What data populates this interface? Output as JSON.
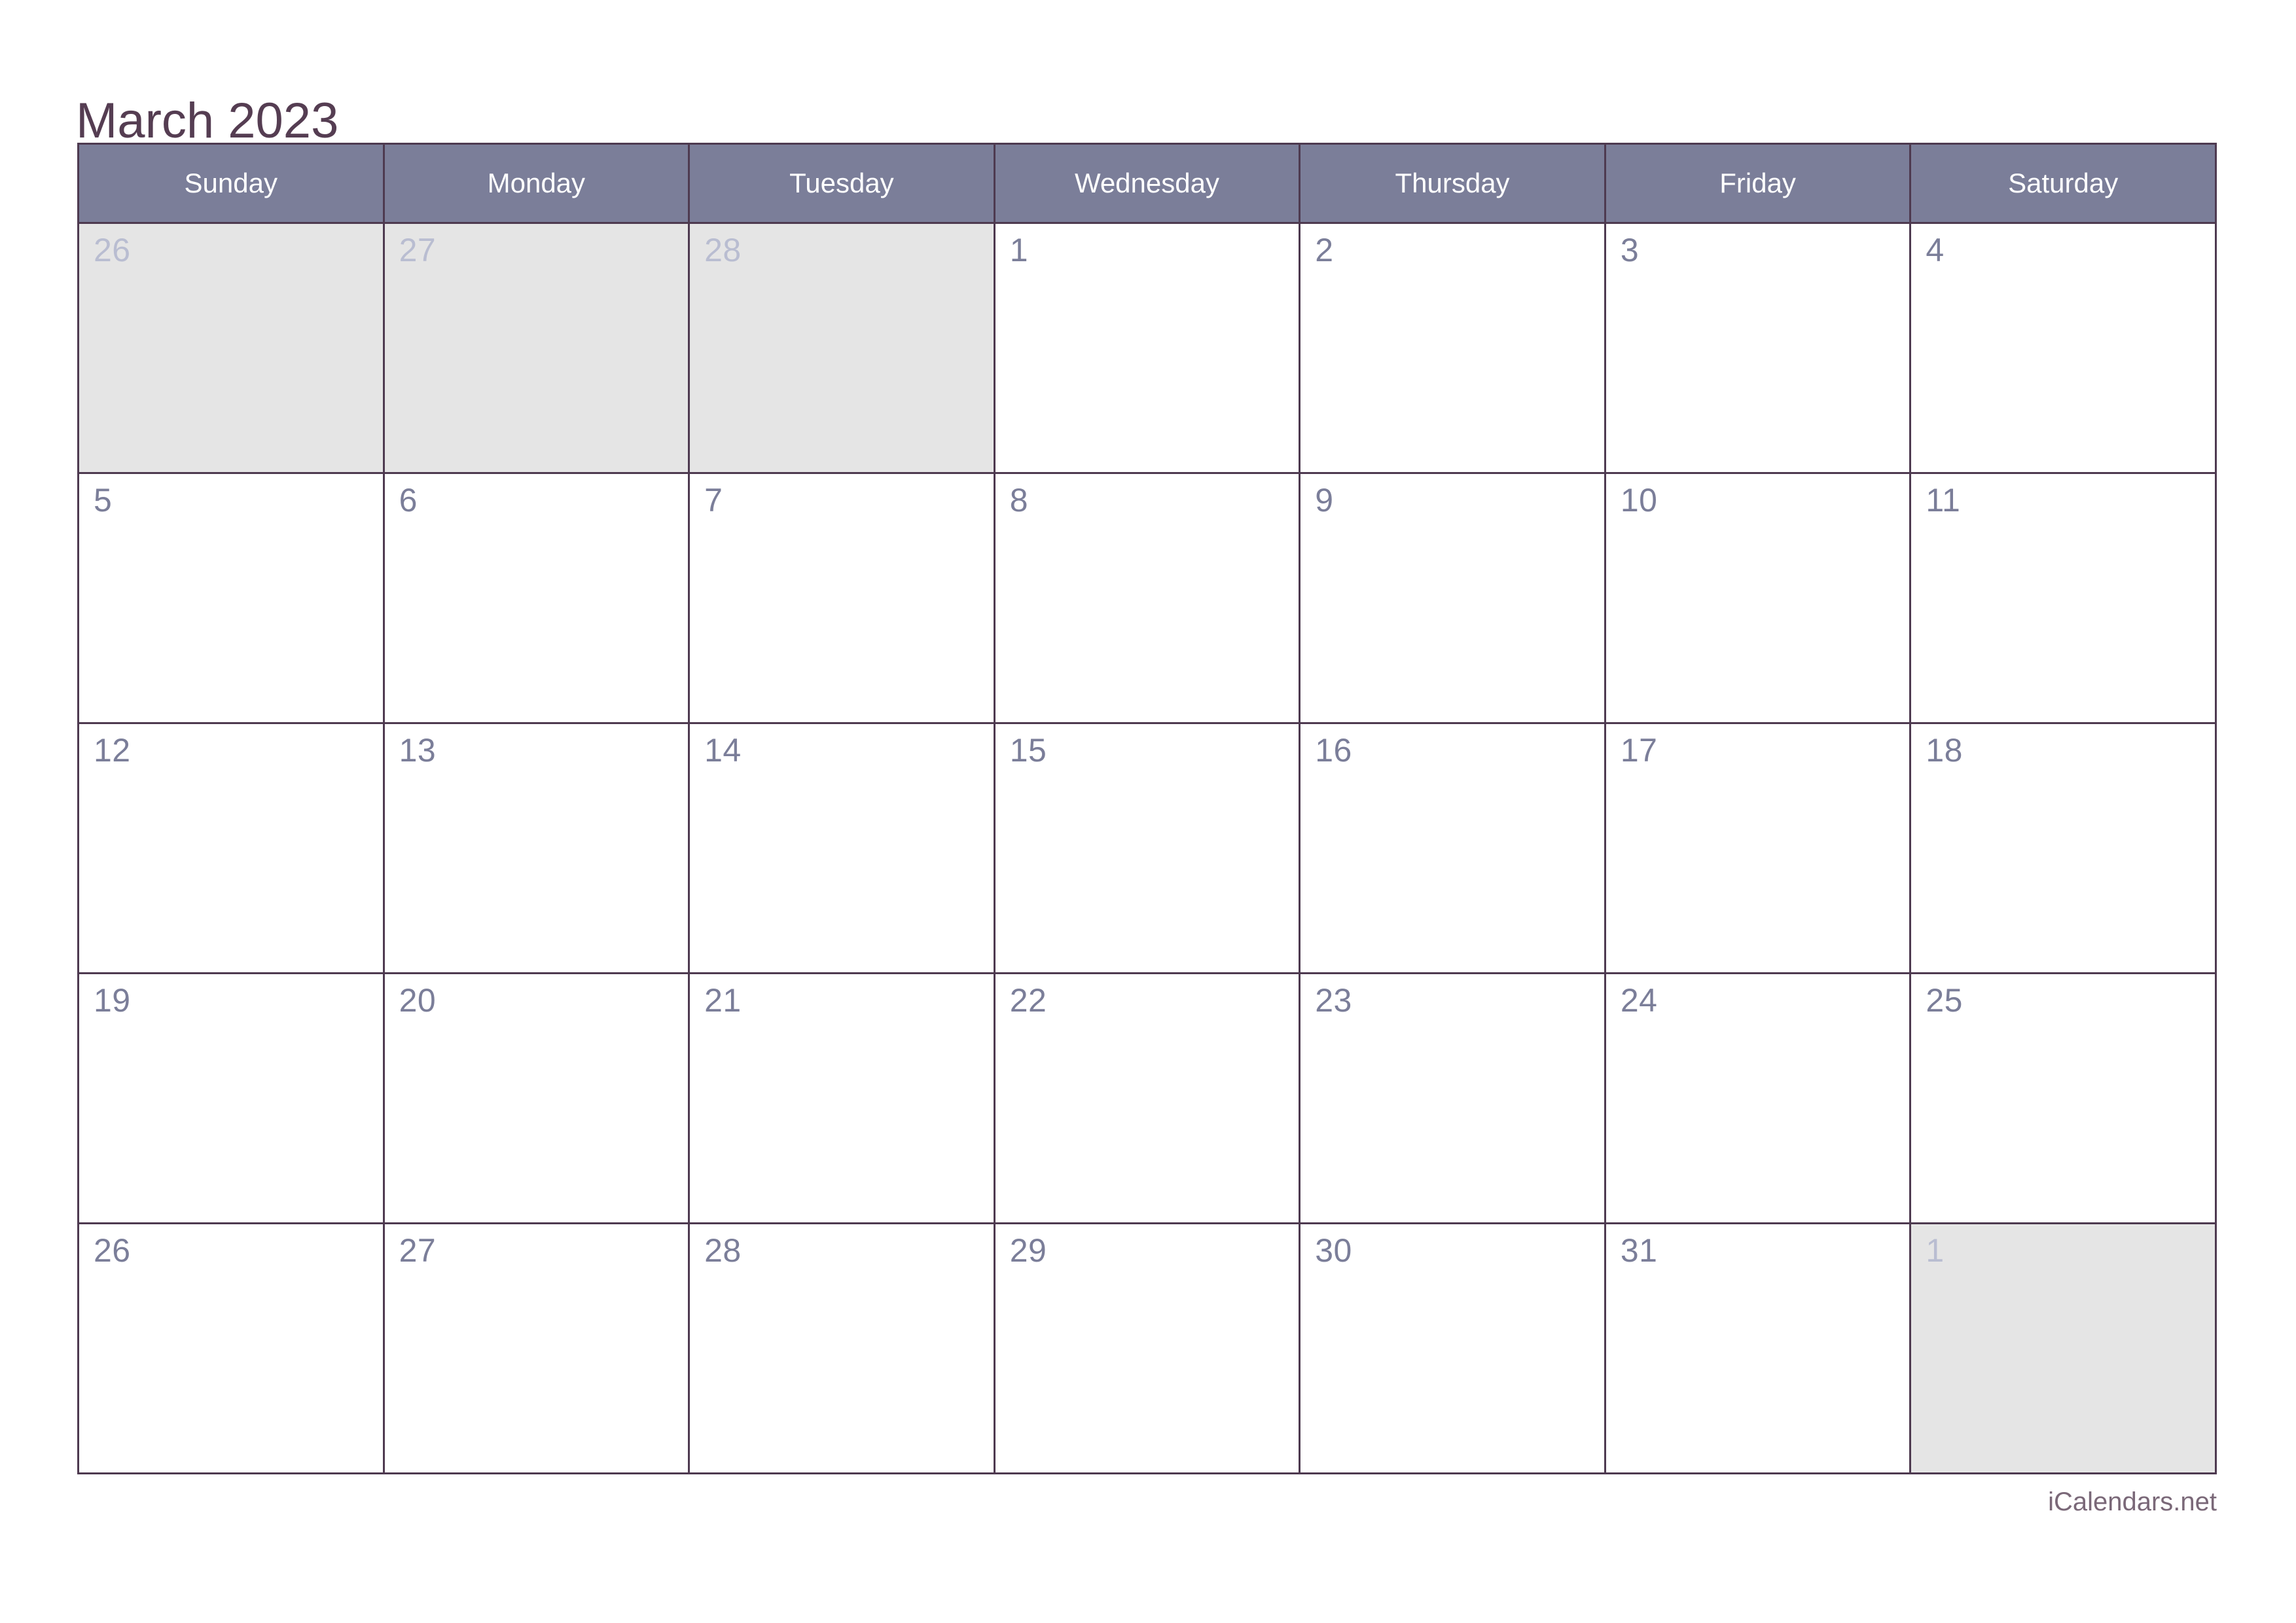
{
  "page": {
    "title": "March 2023",
    "month_name": "March",
    "year": "2023",
    "background_color": "#ffffff"
  },
  "theme": {
    "title_color": "#553d52",
    "header_background": "#7b7e99",
    "header_text_color": "#ffffff",
    "grid_line_color": "#4e3a50",
    "in_month_number_color": "#7b7e99",
    "out_month_number_color": "#b9bdd1",
    "out_month_cell_background": "#e5e5e5",
    "in_month_cell_background": "#ffffff",
    "footer_color": "#7a6878"
  },
  "calendar": {
    "week_start": "Sunday",
    "weekday_headers": [
      "Sunday",
      "Monday",
      "Tuesday",
      "Wednesday",
      "Thursday",
      "Friday",
      "Saturday"
    ],
    "weeks": [
      {
        "index": 0,
        "days": [
          {
            "number": "26",
            "in_month": false,
            "notes": ""
          },
          {
            "number": "27",
            "in_month": false,
            "notes": ""
          },
          {
            "number": "28",
            "in_month": false,
            "notes": ""
          },
          {
            "number": "1",
            "in_month": true,
            "notes": ""
          },
          {
            "number": "2",
            "in_month": true,
            "notes": ""
          },
          {
            "number": "3",
            "in_month": true,
            "notes": ""
          },
          {
            "number": "4",
            "in_month": true,
            "notes": ""
          }
        ]
      },
      {
        "index": 1,
        "days": [
          {
            "number": "5",
            "in_month": true,
            "notes": ""
          },
          {
            "number": "6",
            "in_month": true,
            "notes": ""
          },
          {
            "number": "7",
            "in_month": true,
            "notes": ""
          },
          {
            "number": "8",
            "in_month": true,
            "notes": ""
          },
          {
            "number": "9",
            "in_month": true,
            "notes": ""
          },
          {
            "number": "10",
            "in_month": true,
            "notes": ""
          },
          {
            "number": "11",
            "in_month": true,
            "notes": ""
          }
        ]
      },
      {
        "index": 2,
        "days": [
          {
            "number": "12",
            "in_month": true,
            "notes": ""
          },
          {
            "number": "13",
            "in_month": true,
            "notes": ""
          },
          {
            "number": "14",
            "in_month": true,
            "notes": ""
          },
          {
            "number": "15",
            "in_month": true,
            "notes": ""
          },
          {
            "number": "16",
            "in_month": true,
            "notes": ""
          },
          {
            "number": "17",
            "in_month": true,
            "notes": ""
          },
          {
            "number": "18",
            "in_month": true,
            "notes": ""
          }
        ]
      },
      {
        "index": 3,
        "days": [
          {
            "number": "19",
            "in_month": true,
            "notes": ""
          },
          {
            "number": "20",
            "in_month": true,
            "notes": ""
          },
          {
            "number": "21",
            "in_month": true,
            "notes": ""
          },
          {
            "number": "22",
            "in_month": true,
            "notes": ""
          },
          {
            "number": "23",
            "in_month": true,
            "notes": ""
          },
          {
            "number": "24",
            "in_month": true,
            "notes": ""
          },
          {
            "number": "25",
            "in_month": true,
            "notes": ""
          }
        ]
      },
      {
        "index": 4,
        "days": [
          {
            "number": "26",
            "in_month": true,
            "notes": ""
          },
          {
            "number": "27",
            "in_month": true,
            "notes": ""
          },
          {
            "number": "28",
            "in_month": true,
            "notes": ""
          },
          {
            "number": "29",
            "in_month": true,
            "notes": ""
          },
          {
            "number": "30",
            "in_month": true,
            "notes": ""
          },
          {
            "number": "31",
            "in_month": true,
            "notes": ""
          },
          {
            "number": "1",
            "in_month": false,
            "notes": ""
          }
        ]
      }
    ]
  },
  "footer": {
    "credit": "iCalendars.net"
  }
}
